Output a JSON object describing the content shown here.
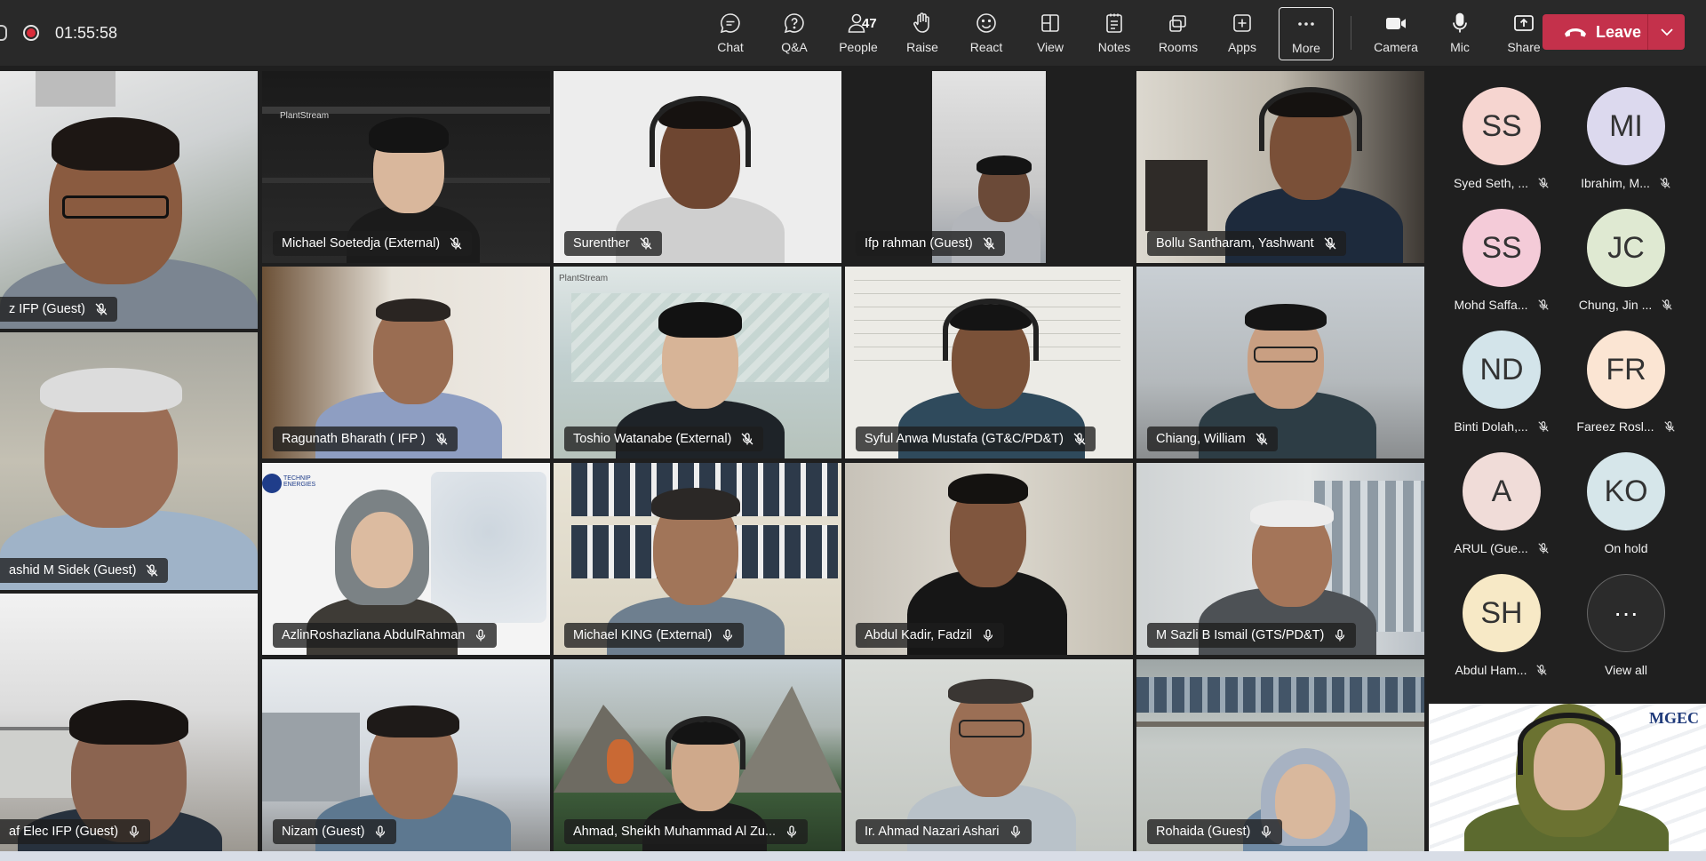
{
  "recording": {
    "time": "01:55:58"
  },
  "toolbar": {
    "chat": "Chat",
    "qa": "Q&A",
    "people": "People",
    "people_count": "47",
    "raise": "Raise",
    "react": "React",
    "view": "View",
    "notes": "Notes",
    "rooms": "Rooms",
    "apps": "Apps",
    "more": "More",
    "camera": "Camera",
    "mic": "Mic",
    "share": "Share",
    "leave": "Leave"
  },
  "tiles": [
    {
      "name": "z IFP (Guest)"
    },
    {
      "name": "Michael Soetedja (External)",
      "logo": "PlantStream"
    },
    {
      "name": "Surenther"
    },
    {
      "name": "Ifp rahman (Guest)"
    },
    {
      "name": "Bollu Santharam, Yashwant"
    },
    {
      "name": "ashid M Sidek (Guest)"
    },
    {
      "name": "Ragunath Bharath ( IFP )"
    },
    {
      "name": "Toshio Watanabe (External)",
      "logo": "PlantStream"
    },
    {
      "name": "Syful Anwa Mustafa (GT&C/PD&T)"
    },
    {
      "name": "Chiang, William"
    },
    {
      "name": "AzlinRoshazliana AbdulRahman",
      "logo": "TECHNIP ENERGIES"
    },
    {
      "name": "Michael KING (External)"
    },
    {
      "name": "Abdul Kadir, Fadzil"
    },
    {
      "name": "M Sazli B Ismail (GTS/PD&T)"
    },
    {
      "name": "af Elec IFP (Guest)"
    },
    {
      "name": "Nizam (Guest)"
    },
    {
      "name": "Ahmad, Sheikh Muhammad Al Zu..."
    },
    {
      "name": "Ir. Ahmad Nazari Ashari"
    },
    {
      "name": "Rohaida (Guest)"
    }
  ],
  "roster": [
    {
      "initials": "SS",
      "name": "Syed Seth, ...",
      "color": "#f6d5d0"
    },
    {
      "initials": "MI",
      "name": "Ibrahim, M...",
      "color": "#dcd9ee"
    },
    {
      "initials": "SS",
      "name": "Mohd Saffa...",
      "color": "#f4cbd8"
    },
    {
      "initials": "JC",
      "name": "Chung, Jin ...",
      "color": "#dfe9d2"
    },
    {
      "initials": "ND",
      "name": "Binti Dolah,...",
      "color": "#d3e4ea"
    },
    {
      "initials": "FR",
      "name": "Fareez Rosl...",
      "color": "#fbe5d3"
    },
    {
      "initials": "A",
      "name": "ARUL (Gue...",
      "color": "#f0dcd8"
    },
    {
      "initials": "KO",
      "name": "On hold",
      "color": "#d6e6ea"
    },
    {
      "initials": "SH",
      "name": "Abdul Ham...",
      "color": "#f7e9c6"
    }
  ],
  "view_all": {
    "label": "View all",
    "glyph": "···"
  },
  "selfview": {
    "logo": "MGEC"
  }
}
